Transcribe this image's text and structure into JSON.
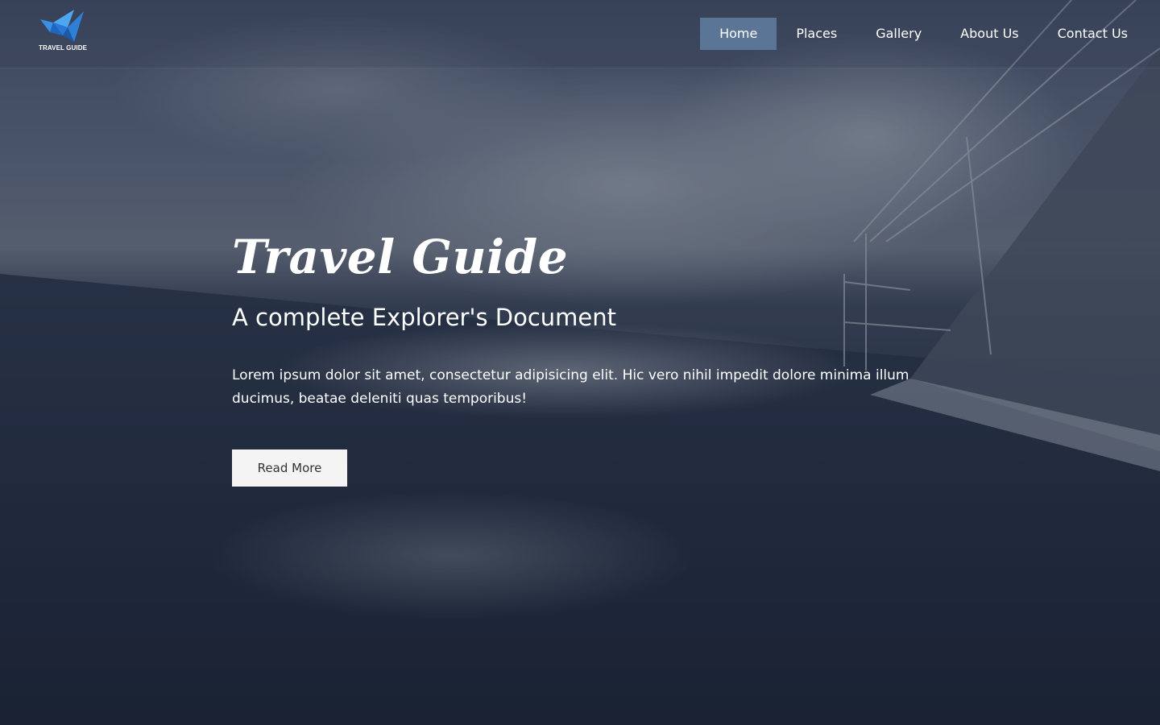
{
  "brand": {
    "logo_text": "TRAVEL GUIDE",
    "logo_icon": "origami-bird-icon",
    "accent_color": "#2e7fd6"
  },
  "nav": {
    "items": [
      {
        "label": "Home",
        "active": true
      },
      {
        "label": "Places",
        "active": false
      },
      {
        "label": "Gallery",
        "active": false
      },
      {
        "label": "About Us",
        "active": false
      },
      {
        "label": "Contact Us",
        "active": false
      }
    ],
    "active_color": "#5b7596"
  },
  "hero": {
    "title": "Travel Guide",
    "subtitle": "A complete Explorer's Document",
    "paragraph": "Lorem ipsum dolor sit amet, consectetur adipisicing elit. Hic vero nihil impedit dolore minima illum ducimus, beatae deleniti quas temporibus!",
    "button_label": "Read More"
  }
}
